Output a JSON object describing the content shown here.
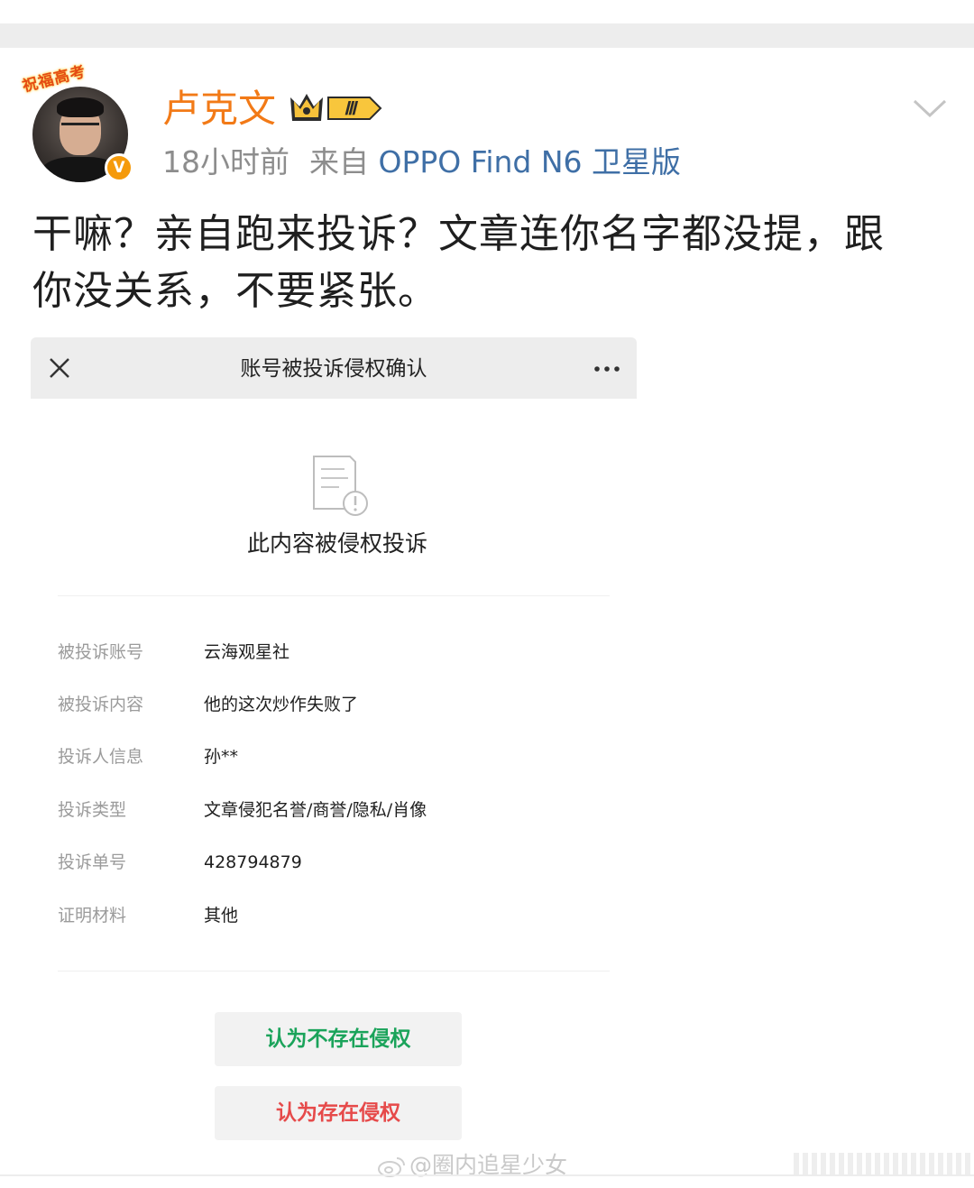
{
  "post": {
    "author": {
      "name": "卢克文",
      "avatar_ribbon": "祝福高考",
      "verified_mark": "V",
      "level_badge": "Ⅲ"
    },
    "time": "18小时前",
    "source_prefix": "来自",
    "source": "OPPO Find N6 卫星版",
    "text": "干嘛？亲自跑来投诉？文章连你名字都没提，跟\n你没关系，不要紧张。"
  },
  "screenshot": {
    "title": "账号被投诉侵权确认",
    "notice": "此内容被侵权投诉",
    "rows": [
      {
        "label": "被投诉账号",
        "value": "云海观星社"
      },
      {
        "label": "被投诉内容",
        "value": "他的这次炒作失败了"
      },
      {
        "label": "投诉人信息",
        "value": "孙**"
      },
      {
        "label": "投诉类型",
        "value": "文章侵犯名誉/商誉/隐私/肖像"
      },
      {
        "label": "投诉单号",
        "value": "428794879"
      },
      {
        "label": "证明材料",
        "value": "其他"
      }
    ],
    "buttons": {
      "no_infringement": "认为不存在侵权",
      "infringement": "认为存在侵权"
    }
  },
  "watermark": "@圈内追星少女",
  "colors": {
    "author_name": "#f27a17",
    "source_link": "#3f6fa6",
    "green_button_text": "#1aa35a",
    "red_button_text": "#e64a4a"
  },
  "icons": [
    "crown-level-icon",
    "more-chevron-icon",
    "close-icon",
    "more-dots-icon",
    "document-warning-icon",
    "weibo-logo-icon"
  ]
}
